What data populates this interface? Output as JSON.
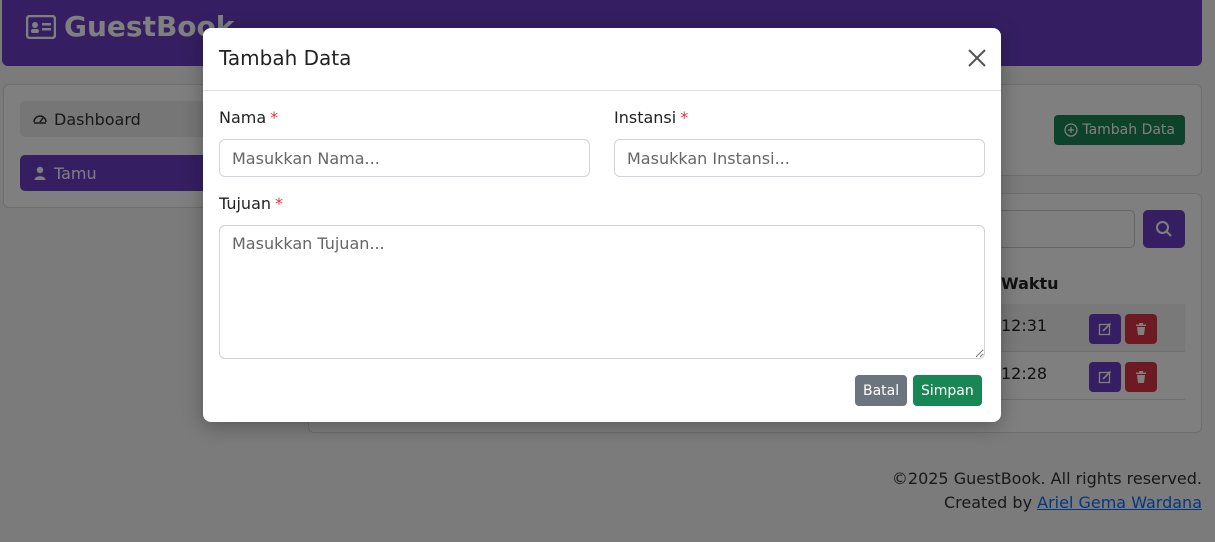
{
  "app": {
    "brand": "GuestBook"
  },
  "sidebar": {
    "items": [
      {
        "label": "Dashboard",
        "icon": "dashboard-icon"
      },
      {
        "label": "Tamu",
        "icon": "user-icon"
      }
    ]
  },
  "toolbar": {
    "add_label": "Tambah Data"
  },
  "table": {
    "column_waktu": "Waktu",
    "rows": [
      {
        "waktu": "12:31"
      },
      {
        "waktu": "12:28"
      }
    ]
  },
  "footer": {
    "copyright": "©2025 GuestBook. All rights reserved.",
    "created_by_prefix": "Created by ",
    "author": "Ariel Gema Wardana"
  },
  "modal": {
    "title": "Tambah Data",
    "fields": {
      "nama": {
        "label": "Nama",
        "required": "*",
        "placeholder": "Masukkan Nama...",
        "value": ""
      },
      "instansi": {
        "label": "Instansi",
        "required": "*",
        "placeholder": "Masukkan Instansi...",
        "value": ""
      },
      "tujuan": {
        "label": "Tujuan",
        "required": "*",
        "placeholder": "Masukkan Tujuan...",
        "value": ""
      }
    },
    "cancel_label": "Batal",
    "save_label": "Simpan"
  },
  "colors": {
    "primary": "#6b3fc4",
    "success": "#198754",
    "danger": "#dc3545",
    "secondary": "#6c757d"
  }
}
